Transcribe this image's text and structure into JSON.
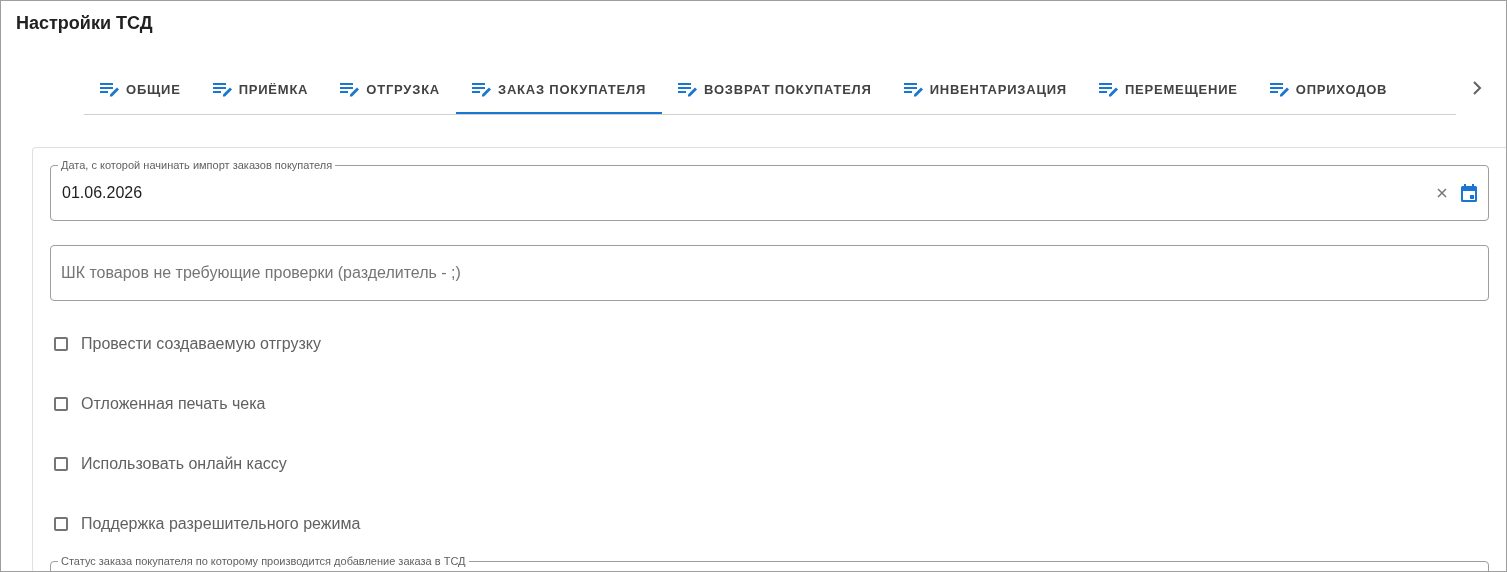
{
  "window": {
    "title": "Настройки ТСД"
  },
  "tabs": [
    {
      "label": "ОБЩИЕ",
      "selected": false
    },
    {
      "label": "ПРИЁМКА",
      "selected": false
    },
    {
      "label": "ОТГРУЗКА",
      "selected": false
    },
    {
      "label": "ЗАКАЗ ПОКУПАТЕЛЯ",
      "selected": true
    },
    {
      "label": "ВОЗВРАТ ПОКУПАТЕЛЯ",
      "selected": false
    },
    {
      "label": "ИНВЕНТАРИЗАЦИЯ",
      "selected": false
    },
    {
      "label": "ПЕРЕМЕЩЕНИЕ",
      "selected": false
    },
    {
      "label": "ОПРИХОДОВ",
      "selected": false
    }
  ],
  "date_field": {
    "label": "Дата, с которой начинать импорт заказов покупателя",
    "value": "01.06.2026"
  },
  "barcode_field": {
    "placeholder": "ШК товаров не требующие проверки (разделитель - ;)"
  },
  "checkboxes": [
    {
      "label": "Провести создаваемую отгрузку",
      "checked": false
    },
    {
      "label": "Отложенная печать чека",
      "checked": false
    },
    {
      "label": "Использовать онлайн кассу",
      "checked": false
    },
    {
      "label": "Поддержка разрешительного режима",
      "checked": false
    }
  ],
  "status_field": {
    "label": "Статус заказа покупателя по которому производится добавление заказа в ТСД"
  }
}
